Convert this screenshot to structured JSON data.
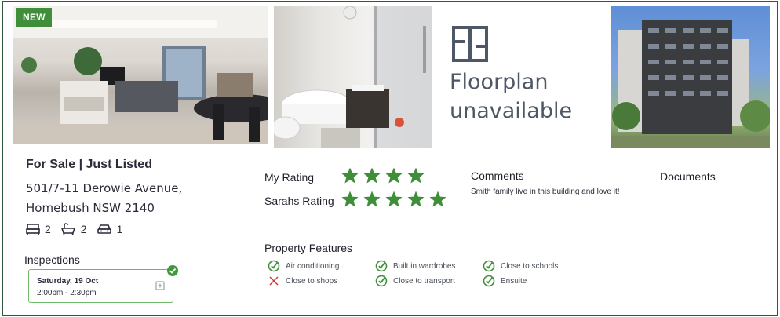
{
  "listing": {
    "badge": "NEW",
    "floorplan_line1": "Floorplan",
    "floorplan_line2": "unavailable",
    "title": "For Sale | Just Listed",
    "address_line1": "501/7-11 Derowie Avenue,",
    "address_line2": "Homebush NSW 2140",
    "beds": "2",
    "baths": "2",
    "cars": "1"
  },
  "inspections": {
    "label": "Inspections",
    "items": [
      {
        "date": "Saturday, 19 Oct",
        "time": "2:00pm - 2:30pm"
      }
    ]
  },
  "ratings": {
    "my_label": "My Rating",
    "my_value": 4,
    "sarahs_label": "Sarahs Rating",
    "sarahs_value": 5,
    "star_color": "#3e8e3a"
  },
  "comments": {
    "label": "Comments",
    "text": "Smith family live in this building and love it!"
  },
  "documents": {
    "label": "Documents"
  },
  "property_features": {
    "label": "Property Features",
    "items": [
      {
        "label": "Air conditioning",
        "status": "check"
      },
      {
        "label": "Built in wardrobes",
        "status": "check"
      },
      {
        "label": "Close to schools",
        "status": "check"
      },
      {
        "label": "Close to shops",
        "status": "cross"
      },
      {
        "label": "Close to transport",
        "status": "check"
      },
      {
        "label": "Ensuite",
        "status": "check"
      }
    ]
  },
  "colors": {
    "border": "#2f5a3a",
    "accent_green": "#3f8f3a",
    "cross_red": "#d9342b"
  }
}
